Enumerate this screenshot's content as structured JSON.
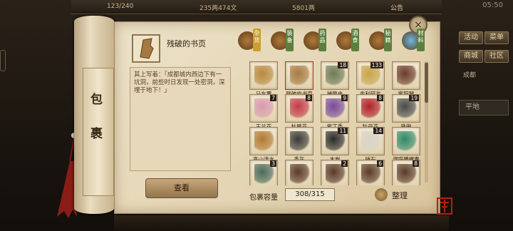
{
  "status": {
    "time": "05:50"
  },
  "topbar": {
    "stat1": "123/240",
    "stat2": "235两474文",
    "stat3": "5801两",
    "announce": "公告"
  },
  "side_menu": {
    "items": [
      "活动",
      "菜单",
      "商城",
      "社区"
    ],
    "location": "成都",
    "terrain": "平地"
  },
  "scroll": {
    "title_chars": [
      "包",
      "裹"
    ]
  },
  "selected": {
    "name": "残破的书页",
    "description": "其上写着：「成都城内西边下有一坑洞，前些时日发现一处密洞，深埋于地下！」"
  },
  "buttons": {
    "view": "查看",
    "sort": "整理",
    "close": "×"
  },
  "tabs": [
    {
      "label": "杂货",
      "color": "#c9a02a"
    },
    {
      "label": "装备",
      "color": "#5d7f3e"
    },
    {
      "label": "药品",
      "color": "#5d7f3e"
    },
    {
      "label": "酒食",
      "color": "#5d7f3e"
    },
    {
      "label": "秘籍",
      "color": "#5d7f3e"
    },
    {
      "label": "材料",
      "color": "#5d7f3e"
    }
  ],
  "inventory": [
    {
      "name": "马车票",
      "count": "",
      "icon": "ticket-icon",
      "color": "#b8893e"
    },
    {
      "name": "残破的书页",
      "count": "",
      "icon": "torn-page-icon",
      "color": "#a57a42"
    },
    {
      "name": "捕兽夹",
      "count": "18",
      "icon": "trap-icon",
      "color": "#6d7a56"
    },
    {
      "name": "舍利碎片",
      "count": "133",
      "icon": "relic-shards-icon",
      "color": "#c9a44a"
    },
    {
      "name": "紫阳琴",
      "count": "",
      "icon": "zither-icon",
      "color": "#6a3a2a"
    },
    {
      "name": "玉兰花",
      "count": "7",
      "icon": "magnolia-icon",
      "color": "#d99ab0"
    },
    {
      "name": "杜鹃花",
      "count": "8",
      "icon": "azalea-icon",
      "color": "#c23b4a"
    },
    {
      "name": "紫丁香",
      "count": "9",
      "icon": "lilac-icon",
      "color": "#7a4a9a"
    },
    {
      "name": "牡丹花",
      "count": "8",
      "icon": "peony-icon",
      "color": "#b0202a"
    },
    {
      "name": "铁锹",
      "count": "19",
      "icon": "shovel-icon",
      "color": "#4a4a4a"
    },
    {
      "name": "高山流水",
      "count": "",
      "icon": "music-scroll-icon",
      "color": "#b07a32"
    },
    {
      "name": "香灰",
      "count": "",
      "icon": "incense-ash-icon",
      "color": "#3a3a3a"
    },
    {
      "name": "木炭",
      "count": "11",
      "icon": "charcoal-icon",
      "color": "#2a2a2a"
    },
    {
      "name": "硝石",
      "count": "14",
      "icon": "saltpeter-icon",
      "color": "#d8d4c8"
    },
    {
      "name": "洞庭碧螺春",
      "count": "",
      "icon": "tea-icon",
      "color": "#2f8a6a"
    },
    {
      "name": "",
      "count": "3",
      "icon": "jar-icon",
      "color": "#4a6a5a"
    },
    {
      "name": "",
      "count": "",
      "icon": "blade-icon",
      "color": "#5a3a2a"
    },
    {
      "name": "",
      "count": "2",
      "icon": "blade-icon",
      "color": "#5a3a2a"
    },
    {
      "name": "",
      "count": "6",
      "icon": "blade-icon",
      "color": "#5a3a2a"
    },
    {
      "name": "",
      "count": "8",
      "icon": "blade-icon",
      "color": "#5a3a2a"
    }
  ],
  "capacity": {
    "label": "包裹容量",
    "value": "308/315"
  },
  "seal": "富开"
}
